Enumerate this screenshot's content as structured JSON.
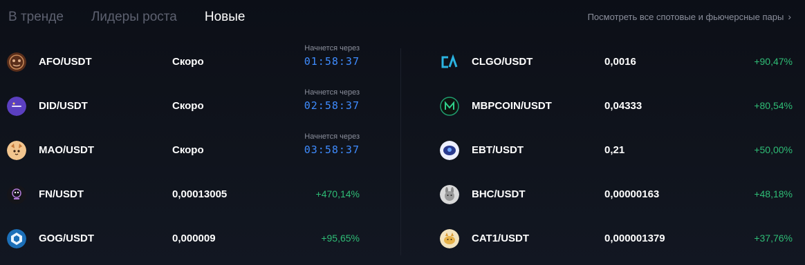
{
  "tabs": [
    {
      "label": "В тренде",
      "active": false
    },
    {
      "label": "Лидеры роста",
      "active": false
    },
    {
      "label": "Новые",
      "active": true
    }
  ],
  "view_all": {
    "label": "Посмотреть все спотовые и фьючерсные пары",
    "icon": "chevron-right-icon"
  },
  "left_column": [
    {
      "pair": "AFO/USDT",
      "price": "Скоро",
      "starts_label": "Начнется через",
      "countdown": "01:58:37",
      "icon": "afo-coin-icon",
      "icon_color": "#6b3a22"
    },
    {
      "pair": "DID/USDT",
      "price": "Скоро",
      "starts_label": "Начнется через",
      "countdown": "02:58:37",
      "icon": "did-coin-icon",
      "icon_color": "#6a4bc9"
    },
    {
      "pair": "MAO/USDT",
      "price": "Скоро",
      "starts_label": "Начнется через",
      "countdown": "03:58:37",
      "icon": "mao-coin-icon",
      "icon_color": "#e2a46a"
    },
    {
      "pair": "FN/USDT",
      "price": "0,00013005",
      "change": "+470,14%",
      "icon": "fn-coin-icon",
      "icon_color": "#1a1a1f"
    },
    {
      "pair": "GOG/USDT",
      "price": "0,000009",
      "change": "+95,65%",
      "icon": "gog-coin-icon",
      "icon_color": "#1b7ec9"
    }
  ],
  "right_column": [
    {
      "pair": "CLGO/USDT",
      "price": "0,0016",
      "change": "+90,47%",
      "icon": "clgo-coin-icon",
      "icon_color": "#2bb3e0"
    },
    {
      "pair": "MBPCOIN/USDT",
      "price": "0,04333",
      "change": "+80,54%",
      "icon": "mbpcoin-coin-icon",
      "icon_color": "#1f9f6e"
    },
    {
      "pair": "EBT/USDT",
      "price": "0,21",
      "change": "+50,00%",
      "icon": "ebt-coin-icon",
      "icon_color": "#2a3a8f"
    },
    {
      "pair": "BHC/USDT",
      "price": "0,00000163",
      "change": "+48,18%",
      "icon": "bhc-coin-icon",
      "icon_color": "#c9c9c9"
    },
    {
      "pair": "CAT1/USDT",
      "price": "0,000001379",
      "change": "+37,76%",
      "icon": "cat1-coin-icon",
      "icon_color": "#e7b24a"
    }
  ],
  "colors": {
    "positive": "#2fbd76",
    "countdown": "#3f8cff",
    "muted": "#8b8f9c",
    "tab_inactive": "#5d6170"
  }
}
